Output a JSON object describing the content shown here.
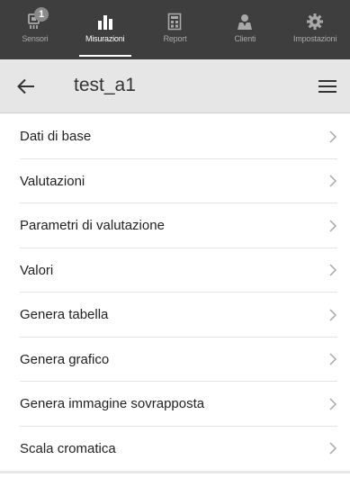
{
  "tabs": [
    {
      "label": "Sensori",
      "icon": "sensor-icon",
      "badge": "1",
      "active": false
    },
    {
      "label": "Misurazioni",
      "icon": "bar-chart-icon",
      "active": true
    },
    {
      "label": "Report",
      "icon": "report-icon",
      "active": false
    },
    {
      "label": "Clienti",
      "icon": "person-icon",
      "active": false
    },
    {
      "label": "Impostazioni",
      "icon": "gear-icon",
      "active": false
    }
  ],
  "header": {
    "title": "test_a1",
    "back_icon": "back-arrow-icon",
    "menu_icon": "hamburger-menu-icon"
  },
  "menu_items": [
    {
      "label": "Dati di base"
    },
    {
      "label": "Valutazioni"
    },
    {
      "label": "Parametri di valutazione"
    },
    {
      "label": "Valori"
    },
    {
      "label": "Genera tabella"
    },
    {
      "label": "Genera grafico"
    },
    {
      "label": "Genera immagine sovrapposta"
    },
    {
      "label": "Scala cromatica"
    }
  ],
  "colors": {
    "nav_bg": "#3e3e3e",
    "header_bg": "#e6e6e6",
    "chevron": "#a8a8a8"
  }
}
